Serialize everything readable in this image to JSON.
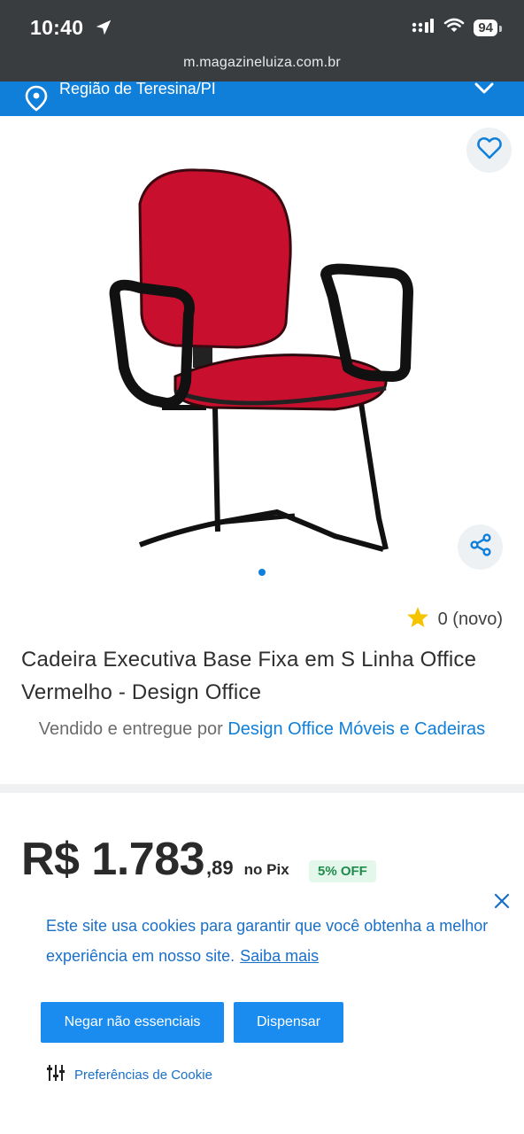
{
  "status_bar": {
    "time": "10:40",
    "battery": "94",
    "url": "m.magazineluiza.com.br"
  },
  "region": {
    "label": "Região de Teresina/PI"
  },
  "product": {
    "title": "Cadeira Executiva Base Fixa em S Linha Office Vermelho - Design Office",
    "rating_text": "0 (novo)",
    "seller_prefix": "Vendido e entregue por",
    "seller_name": "Design Office Móveis e Cadeiras",
    "price_main": "R$ 1.783",
    "price_cents": ",89",
    "price_method": "no Pix",
    "discount": "5% OFF"
  },
  "cookie_banner": {
    "text": "Este site usa cookies para garantir que você obtenha a melhor experiência em nosso site.",
    "link": "Saiba mais",
    "deny_button": "Negar não essenciais",
    "dismiss_button": "Dispensar",
    "preferences": "Preferências de Cookie"
  },
  "colors": {
    "brand_blue": "#0f7fd9",
    "status_bar": "#3a3d40",
    "discount_green": "#1f8b4c",
    "chair_red": "#c8102e"
  }
}
